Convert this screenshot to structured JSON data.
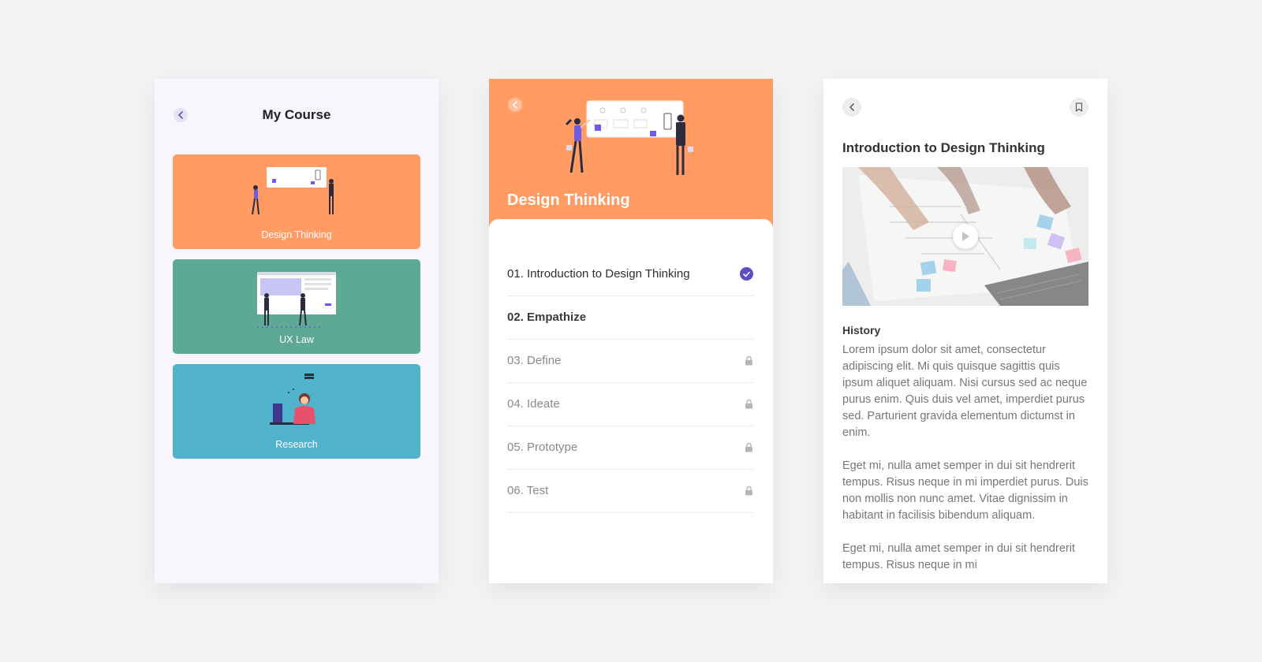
{
  "screen1": {
    "title": "My Course",
    "courses": [
      {
        "label": "Design Thinking",
        "color": "#ff9b63"
      },
      {
        "label": "UX Law",
        "color": "#5da993"
      },
      {
        "label": "Research",
        "color": "#51b2cb"
      }
    ]
  },
  "screen2": {
    "title": "Design Thinking",
    "header_color": "#ff9b63",
    "lessons": [
      {
        "label": "01. Introduction to Design Thinking",
        "status": "completed"
      },
      {
        "label": "02. Empathize",
        "status": "available"
      },
      {
        "label": "03. Define",
        "status": "locked"
      },
      {
        "label": "04. Ideate",
        "status": "locked"
      },
      {
        "label": "05. Prototype",
        "status": "locked"
      },
      {
        "label": "06. Test",
        "status": "locked"
      }
    ],
    "accent": "#5b4ec2"
  },
  "screen3": {
    "title": "Introduction to Design Thinking",
    "section_title": "History",
    "paragraphs": [
      "Lorem ipsum dolor sit amet, consectetur adipiscing elit. Mi quis quisque sagittis quis ipsum aliquet aliquam. Nisi cursus sed ac neque purus enim. Quis duis vel amet, imperdiet purus sed. Parturient gravida elementum dictumst in enim.",
      "Eget mi, nulla amet semper in dui sit hendrerit tempus. Risus neque in mi imperdiet purus. Duis non mollis non nunc amet. Vitae dignissim in habitant in facilisis bibendum aliquam.",
      "Eget mi, nulla amet semper in dui sit hendrerit tempus. Risus neque in mi"
    ]
  }
}
